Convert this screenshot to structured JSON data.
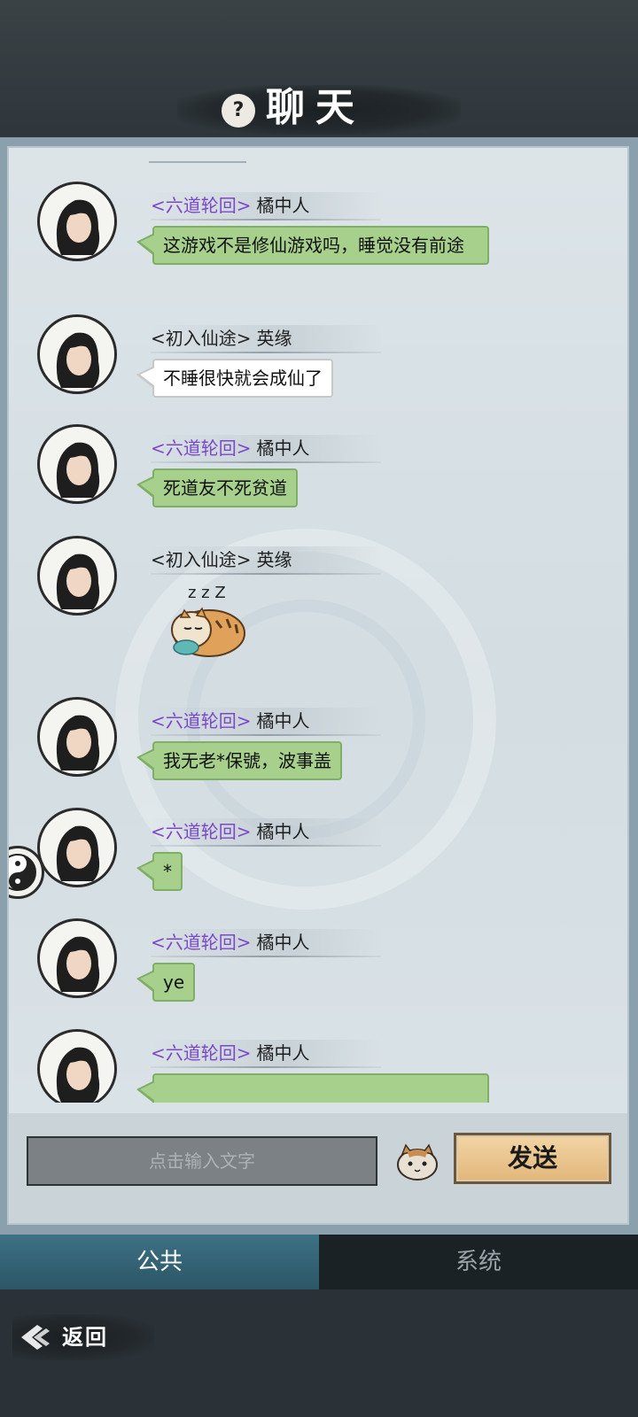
{
  "header": {
    "help_label": "?",
    "title": "聊天"
  },
  "messages": [
    {
      "guild": "<六道轮回>",
      "guild_style": "purple",
      "name": "橘中人",
      "text": "这游戏不是修仙游戏吗，睡觉没有前途",
      "bubble": "green"
    },
    {
      "guild": "<初入仙途>",
      "guild_style": "plain",
      "name": "英缘",
      "text": "不睡很快就会成仙了",
      "bubble": "white"
    },
    {
      "guild": "<六道轮回>",
      "guild_style": "purple",
      "name": "橘中人",
      "text": "死道友不死贫道",
      "bubble": "green"
    },
    {
      "guild": "<初入仙途>",
      "guild_style": "plain",
      "name": "英缘",
      "sticker": "sleeping-tiger-sticker",
      "sticker_text": "z z Z"
    },
    {
      "guild": "<六道轮回>",
      "guild_style": "purple",
      "name": "橘中人",
      "text": "我无老*保號，波事盖",
      "bubble": "green"
    },
    {
      "guild": "<六道轮回>",
      "guild_style": "purple",
      "name": "橘中人",
      "text": "*",
      "bubble": "green"
    },
    {
      "guild": "<六道轮回>",
      "guild_style": "purple",
      "name": "橘中人",
      "text": "ye",
      "bubble": "green"
    },
    {
      "guild": "<六道轮回>",
      "guild_style": "purple",
      "name": "橘中人",
      "text": "",
      "bubble": "green"
    }
  ],
  "composer": {
    "placeholder": "点击输入文字",
    "send_label": "发送",
    "emoji_icon": "tiger-emoji-icon"
  },
  "tabs": [
    {
      "label": "公共",
      "active": true
    },
    {
      "label": "系统",
      "active": false
    }
  ],
  "footer": {
    "back_label": "返回"
  },
  "colors": {
    "guild_purple": "#7b48c8",
    "bubble_green": "#a6d08b",
    "tab_active": "#3d7184",
    "send_button": "#e2b67a"
  }
}
